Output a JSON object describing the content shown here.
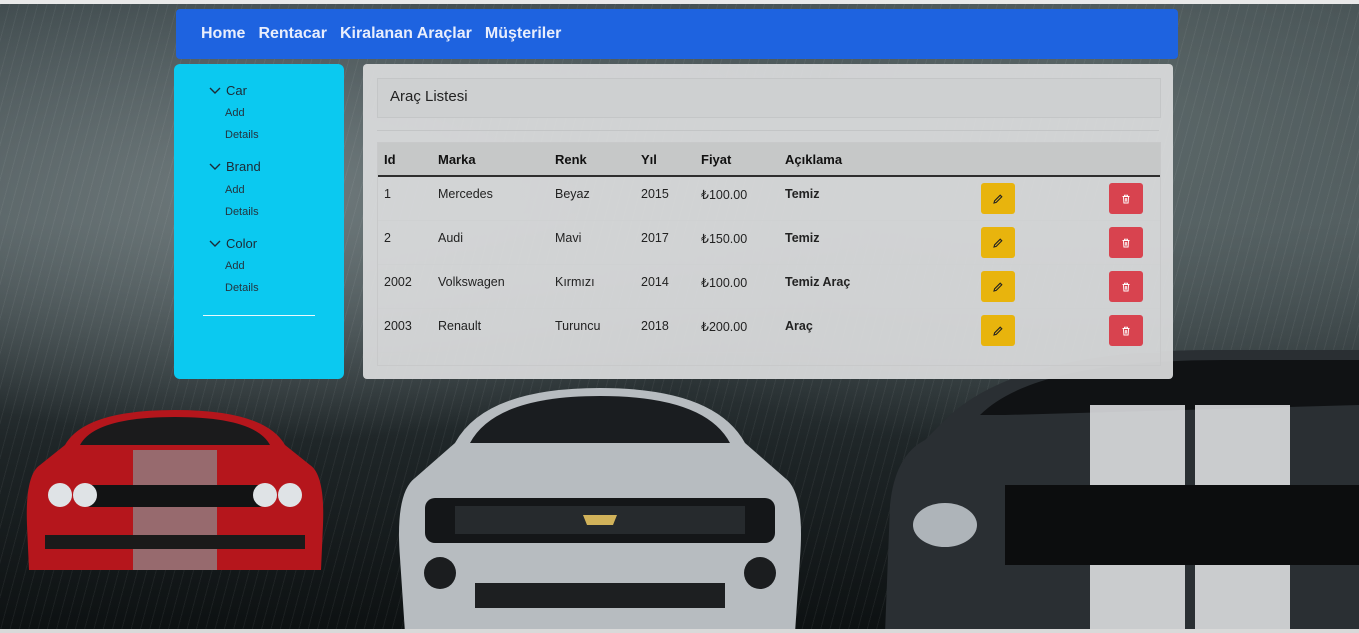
{
  "nav": {
    "links": [
      "Home",
      "Rentacar",
      "Kiralanan Araçlar",
      "Müşteriler"
    ]
  },
  "sidebar": {
    "groups": [
      {
        "title": "Car",
        "items": [
          "Add",
          "Details"
        ]
      },
      {
        "title": "Brand",
        "items": [
          "Add",
          "Details"
        ]
      },
      {
        "title": "Color",
        "items": [
          "Add",
          "Details"
        ]
      }
    ]
  },
  "panel": {
    "title": "Araç Listesi",
    "columns": [
      "Id",
      "Marka",
      "Renk",
      "Yıl",
      "Fiyat",
      "Açıklama"
    ],
    "rows": [
      {
        "id": "1",
        "brand": "Mercedes",
        "color": "Beyaz",
        "year": "2015",
        "price": "₺100.00",
        "desc": "Temiz"
      },
      {
        "id": "2",
        "brand": "Audi",
        "color": "Mavi",
        "year": "2017",
        "price": "₺150.00",
        "desc": "Temiz"
      },
      {
        "id": "2002",
        "brand": "Volkswagen",
        "color": "Kırmızı",
        "year": "2014",
        "price": "₺100.00",
        "desc": "Temiz Araç"
      },
      {
        "id": "2003",
        "brand": "Renault",
        "color": "Turuncu",
        "year": "2018",
        "price": "₺200.00",
        "desc": "Araç"
      }
    ]
  },
  "icons": {
    "edit": "pencil-icon",
    "delete": "trash-icon",
    "expand": "chevron-down-icon"
  },
  "colors": {
    "navbar": "#1e63e0",
    "sidebar": "#0bc9f0",
    "edit_button": "#e8b40d",
    "delete_button": "#d8434f"
  }
}
